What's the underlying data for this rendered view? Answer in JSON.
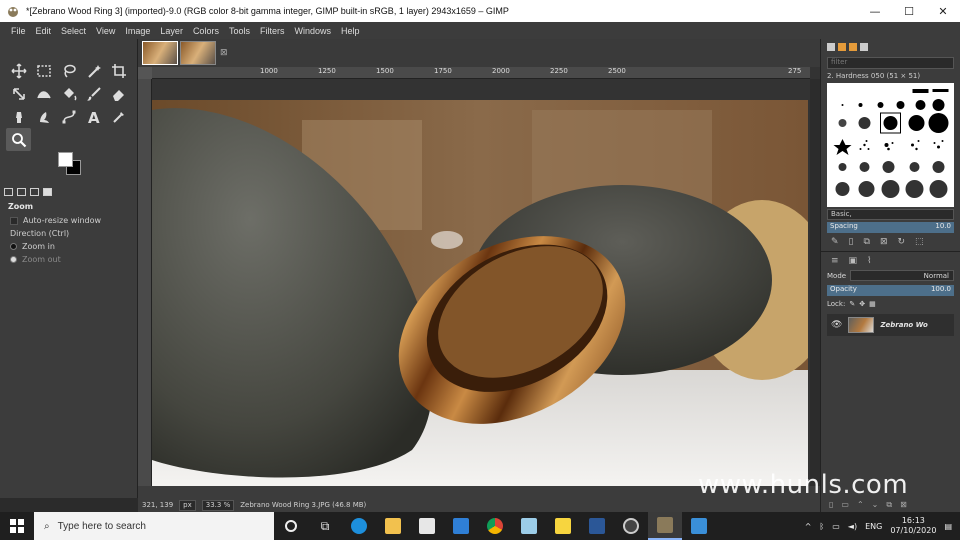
{
  "window": {
    "title": "*[Zebrano Wood Ring 3] (imported)-9.0 (RGB color 8-bit gamma integer, GIMP built-in sRGB, 1 layer) 2943x1659 – GIMP",
    "minimize": "—",
    "maximize": "☐",
    "close": "✕"
  },
  "menu": [
    "File",
    "Edit",
    "Select",
    "View",
    "Image",
    "Layer",
    "Colors",
    "Tools",
    "Filters",
    "Windows",
    "Help"
  ],
  "tools": [
    "move",
    "rect-select",
    "lasso",
    "fuzzy-select",
    "crop",
    "unified-transform",
    "warp",
    "bucket-fill",
    "paintbrush",
    "eraser",
    "clone",
    "smudge",
    "paths",
    "text",
    "color-picker",
    "zoom"
  ],
  "tool_options": {
    "title": "Zoom",
    "auto_resize": "Auto-resize window",
    "direction": "Direction  (Ctrl)",
    "zoom_in": "Zoom in",
    "zoom_out": "Zoom out"
  },
  "ruler": {
    "ticks": [
      "1000",
      "1250",
      "1500",
      "1750",
      "2000",
      "2250",
      "2500",
      "275"
    ]
  },
  "status": {
    "coords": "321, 139",
    "unit": "px",
    "zoom": "33.3 %",
    "file": "Zebrano Wood Ring 3.JPG (46.8 MB)"
  },
  "brushes": {
    "filter_placeholder": "filter",
    "current": "2. Hardness 050 (51 × 51)",
    "tag": "Basic,",
    "spacing_label": "Spacing",
    "spacing_value": "10.0"
  },
  "layers": {
    "mode_label": "Mode",
    "mode_value": "Normal",
    "opacity_label": "Opacity",
    "opacity_value": "100.0",
    "lock_label": "Lock:",
    "layer_name": "Zebrano Wo"
  },
  "watermark": "www.hunls.com",
  "taskbar": {
    "search_placeholder": "Type here to search",
    "lang": "ENG",
    "time": "16:13",
    "date": "07/10/2020"
  },
  "colors": {
    "accent": "#4d6f8a",
    "panel": "#3c3c3c",
    "taskbar": "#1f1f1f"
  }
}
